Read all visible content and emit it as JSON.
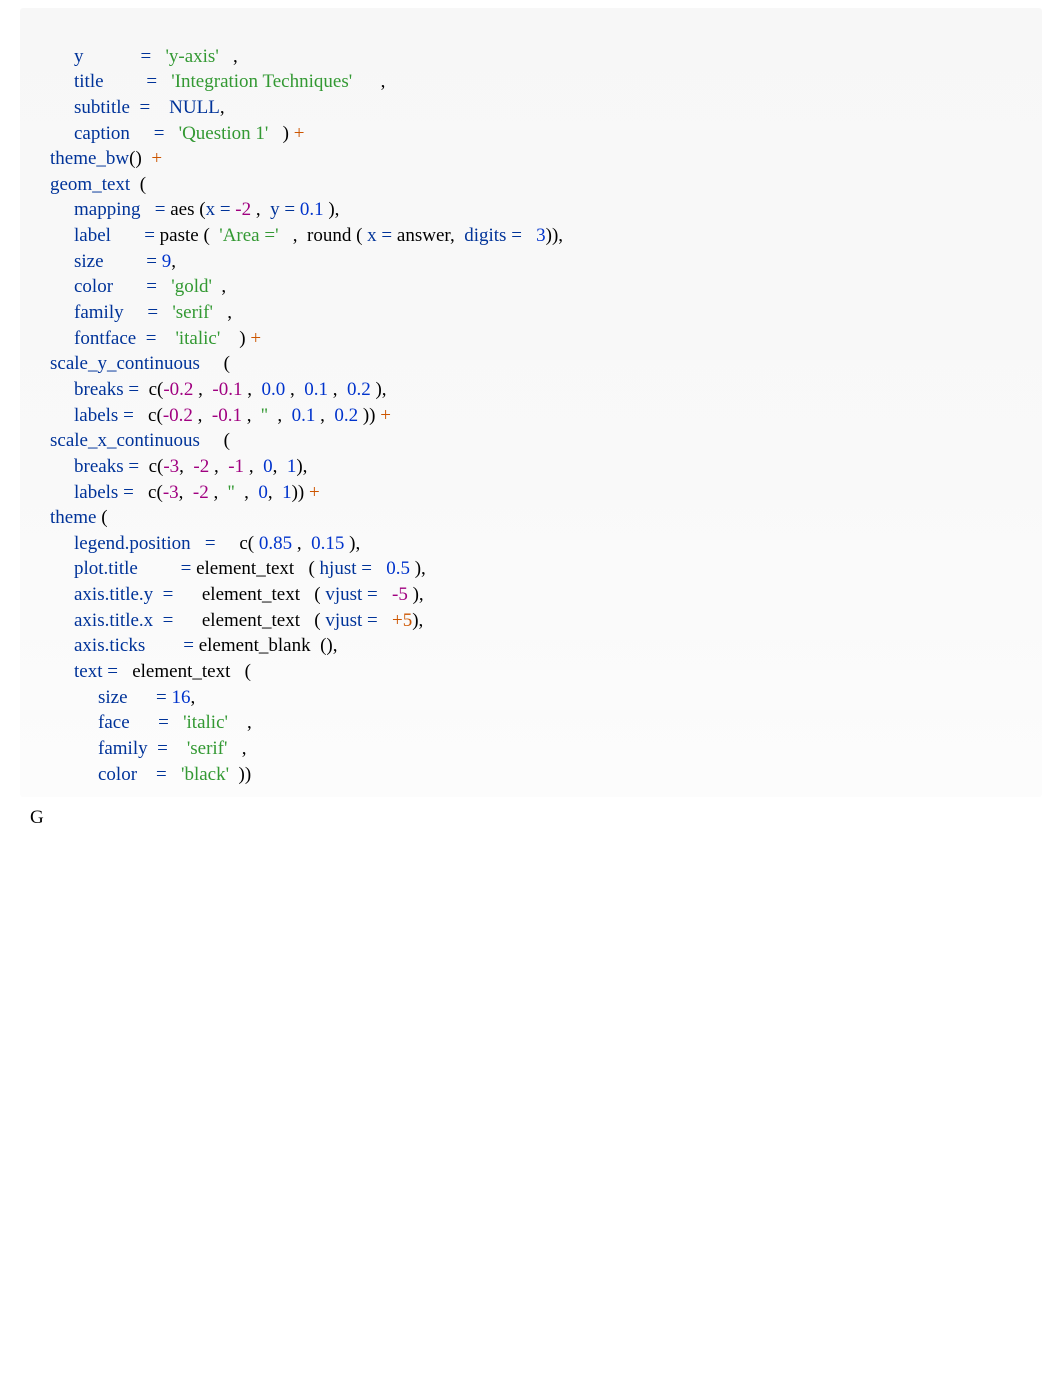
{
  "code": {
    "l1_key": "y",
    "l1_eq": "=",
    "l1_val": "'y-axis'",
    "l1_comma": ",",
    "l2_key": "title",
    "l2_eq": "=",
    "l2_val": "'Integration Techniques'",
    "l2_comma": ",",
    "l3_key": "subtitle",
    "l3_eq": "=",
    "l3_val": "NULL",
    "l3_comma": ",",
    "l4_key": "caption",
    "l4_eq": "=",
    "l4_val": "'Question 1'",
    "l4_close": ") +",
    "l5_fn": "theme_bw",
    "l5_par": "()",
    "l5_plus": "+",
    "l6_fn": "geom_text",
    "l6_open": "(",
    "l7_key": "mapping",
    "l7_eq": "=",
    "l7_aes": "aes",
    "l7_aes_open": "(",
    "l7_x": "x",
    "l7_xeq": "=",
    "l7_xv": "-2",
    "l7_c1": ",",
    "l7_y": "y",
    "l7_yeq": "=",
    "l7_yv": "0.1",
    "l7_close": "),",
    "l8_key": "label",
    "l8_eq": "=",
    "l8_paste": "paste",
    "l8_open": "(",
    "l8_area": "'Area ='",
    "l8_c1": ",",
    "l8_round": "round",
    "l8_ropen": "(",
    "l8_x": "x",
    "l8_xeq": "=",
    "l8_ans": "answer,",
    "l8_dig": "digits",
    "l8_deq": "=",
    "l8_dv": "3",
    "l8_close": ")),",
    "l9_key": "size",
    "l9_eq": "=",
    "l9_v": "9",
    "l9_comma": ",",
    "l10_key": "color",
    "l10_eq": "=",
    "l10_v": "'gold'",
    "l10_comma": ",",
    "l11_key": "family",
    "l11_eq": "=",
    "l11_v": "'serif'",
    "l11_comma": ",",
    "l12_key": "fontface",
    "l12_eq": "=",
    "l12_v": "'italic'",
    "l12_close": ") +",
    "l13_fn": "scale_y_continuous",
    "l13_open": "(",
    "l14_key": "breaks",
    "l14_eq": "=",
    "l14_c": "c",
    "l14_open": "(",
    "l14_v1": "-0.2",
    "l14_v2": "-0.1",
    "l14_v3": "0.0",
    "l14_v4": "0.1",
    "l14_v5": "0.2",
    "l14_close": "),",
    "l15_key": "labels",
    "l15_eq": "=",
    "l15_c": "c",
    "l15_open": "(",
    "l15_v1": "-0.2",
    "l15_v2": "-0.1",
    "l15_v3": "''",
    "l15_v4": "0.1",
    "l15_v5": "0.2",
    "l15_close": ")) +",
    "l16_fn": "scale_x_continuous",
    "l16_open": "(",
    "l17_key": "breaks",
    "l17_eq": "=",
    "l17_c": "c",
    "l17_open": "(",
    "l17_v1": "-3",
    "l17_v2": "-2",
    "l17_v3": "-1",
    "l17_v4": "0",
    "l17_v5": "1",
    "l17_close": "),",
    "l18_key": "labels",
    "l18_eq": "=",
    "l18_c": "c",
    "l18_open": "(",
    "l18_v1": "-3",
    "l18_v2": "-2",
    "l18_v3": "''",
    "l18_v4": "0",
    "l18_v5": "1",
    "l18_close": ")) +",
    "l19_fn": "theme",
    "l19_open": "(",
    "l20_key": "legend.position",
    "l20_eq": "=",
    "l20_c": "c",
    "l20_open": "(",
    "l20_v1": "0.85",
    "l20_v2": "0.15",
    "l20_close": "),",
    "l21_key": "plot.title",
    "l21_eq": "=",
    "l21_fn": "element_text",
    "l21_open": "(",
    "l21_arg": "hjust",
    "l21_aeq": "=",
    "l21_av": "0.5",
    "l21_close": "),",
    "l22_key": "axis.title.y",
    "l22_eq": "=",
    "l22_fn": "element_text",
    "l22_open": "(",
    "l22_arg": "vjust",
    "l22_aeq": "=",
    "l22_av": "-5",
    "l22_close": "),",
    "l23_key": "axis.title.x",
    "l23_eq": "=",
    "l23_fn": "element_text",
    "l23_open": "(",
    "l23_arg": "vjust",
    "l23_aeq": "=",
    "l23_av": "+5",
    "l23_close": "),",
    "l24_key": "axis.ticks",
    "l24_eq": "=",
    "l24_fn": "element_blank",
    "l24_close": "(),",
    "l25_key": "text",
    "l25_eq": "=",
    "l25_fn": "element_text",
    "l25_open": "(",
    "l26_key": "size",
    "l26_eq": "=",
    "l26_v": "16",
    "l26_comma": ",",
    "l27_key": "face",
    "l27_eq": "=",
    "l27_v": "'italic'",
    "l27_comma": ",",
    "l28_key": "family",
    "l28_eq": "=",
    "l28_v": "'serif'",
    "l28_comma": ",",
    "l29_key": "color",
    "l29_eq": "=",
    "l29_v": "'black'",
    "l29_close": "))"
  },
  "footer": "G"
}
